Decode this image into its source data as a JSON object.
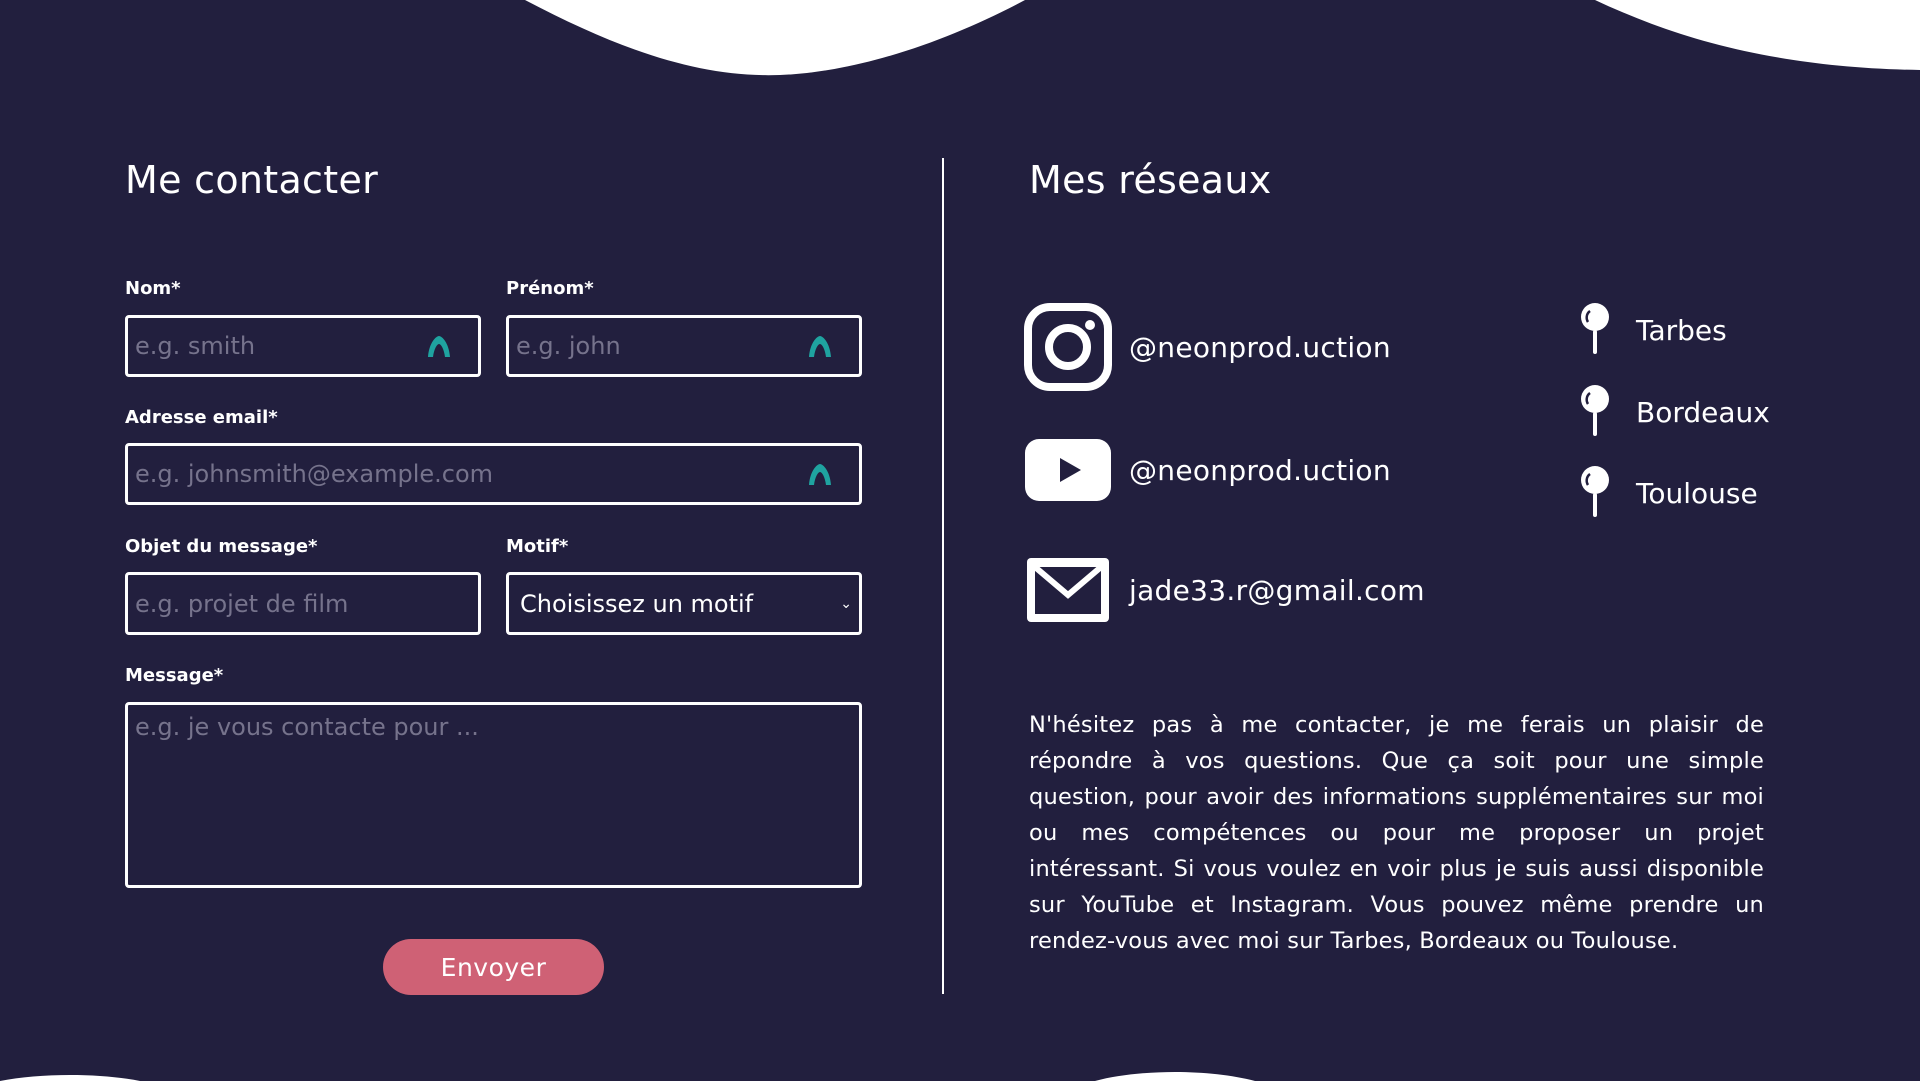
{
  "contact": {
    "title": "Me contacter",
    "fields": {
      "nom": {
        "label": "Nom*",
        "placeholder": "e.g. smith"
      },
      "prenom": {
        "label": "Prénom*",
        "placeholder": "e.g. john"
      },
      "email": {
        "label": "Adresse email*",
        "placeholder": "e.g. johnsmith@example.com"
      },
      "objet": {
        "label": "Objet du message*",
        "placeholder": "e.g. projet de film"
      },
      "motif": {
        "label": "Motif*",
        "selected": "Choisissez un motif"
      },
      "message": {
        "label": "Message*",
        "placeholder": "e.g. je vous contacte pour ..."
      }
    },
    "submit_label": "Envoyer"
  },
  "networks": {
    "title": "Mes réseaux",
    "socials": [
      {
        "icon": "instagram-icon",
        "text": "@neonprod.uction"
      },
      {
        "icon": "youtube-icon",
        "text": "@neonprod.uction"
      },
      {
        "icon": "mail-icon",
        "text": "jade33.r@gmail.com"
      }
    ],
    "locations": [
      {
        "icon": "pin-icon",
        "name": "Tarbes"
      },
      {
        "icon": "pin-icon",
        "name": "Bordeaux"
      },
      {
        "icon": "pin-icon",
        "name": "Toulouse"
      }
    ],
    "description": "N'hésitez pas à me contacter, je me ferais un plaisir de répondre à vos questions. Que ça soit pour une simple question, pour avoir des informations supplémentaires sur moi ou mes compétences ou pour me proposer un projet intéressant. Si vous voulez en voir plus je suis aussi disponible sur YouTube et Instagram. Vous pouvez même prendre un rendez-vous avec moi sur Tarbes, Bordeaux ou Toulouse."
  },
  "colors": {
    "background": "#221f3e",
    "button": "#cf6175",
    "checkmark": "#1fa3a0",
    "placeholder": "#76738c"
  }
}
